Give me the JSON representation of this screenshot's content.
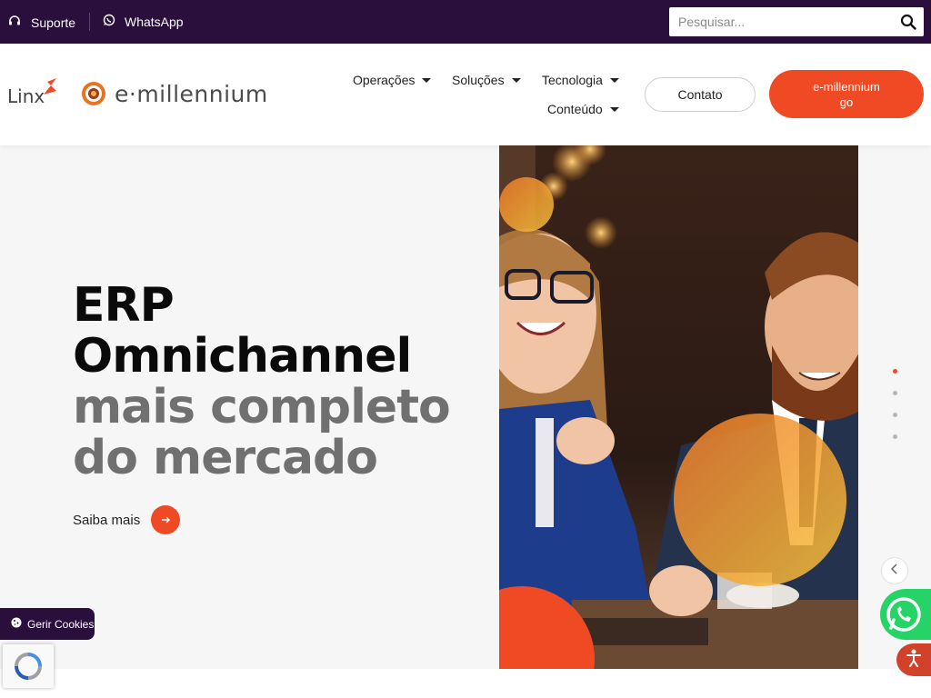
{
  "topbar": {
    "support_label": "Suporte",
    "whatsapp_label": "WhatsApp",
    "search_placeholder": "Pesquisar..."
  },
  "header": {
    "linx_logo_text": "Linx",
    "brand_logo_text": "e·millennium",
    "nav": [
      {
        "label": "Operações"
      },
      {
        "label": "Soluções"
      },
      {
        "label": "Tecnologia"
      },
      {
        "label": "Conteúdo"
      }
    ],
    "contact_button": "Contato",
    "go_button": "e-millennium go"
  },
  "hero": {
    "line1": "ERP",
    "line2": "Omnichannel",
    "line3": "mais completo",
    "line4": "do mercado",
    "cta_label": "Saiba mais",
    "slide_count": 4,
    "active_slide": 1
  },
  "widgets": {
    "cookies_label": "Gerir Cookies"
  },
  "colors": {
    "topbar_bg": "#2a0f3d",
    "accent": "#f04a25",
    "hero_bg": "#f6f6f6",
    "whatsapp": "#25d366"
  },
  "icons": {
    "support": "headset-icon",
    "whatsapp": "whatsapp-icon",
    "search": "search-icon",
    "cta_arrow": "arrow-right-icon",
    "prev": "chevron-left-icon",
    "cookie": "cookie-icon",
    "accessibility": "accessibility-icon",
    "recaptcha": "recaptcha-icon"
  }
}
